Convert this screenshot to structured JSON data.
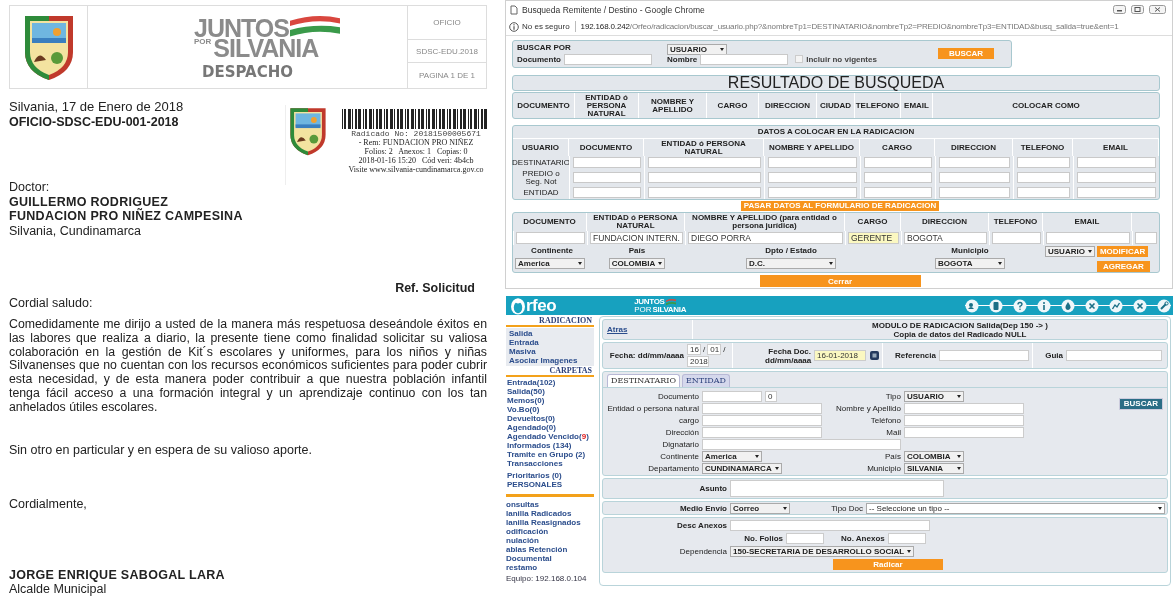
{
  "letter": {
    "header": {
      "brand_top": "JUNTOS",
      "brand_small": "POR",
      "brand_bottom": "SILVANIA",
      "office": "DESPACHO",
      "codes": [
        "OFICIO",
        "SDSC-EDU.2018",
        "PAGINA 1 DE 1"
      ]
    },
    "date": "Silvania, 17 de Enero de 2018",
    "reference_number": "OFICIO-SDSC-EDU-001-2018",
    "stamp": {
      "number": "Radicado No: 20181500005671",
      "lines": [
        "- Rem: FUNDACION PRO NIÑEZ",
        "Folios: 2   Anexos: 1   Copias: 0",
        "2018-01-16 15:20   Cód veri: 4b4cb",
        "Visite www.silvania-cundinamarca.gov.co"
      ]
    },
    "salutation": "Doctor:",
    "recipient": [
      "GUILLERMO  RODRIGUEZ",
      "FUNDACION PRO NIÑEZ CAMPESINA"
    ],
    "location": "Silvania, Cundinamarca",
    "subject": "Ref. Solicitud",
    "greeting": "Cordial saludo:",
    "body": "Comedidamente me dirijo a usted de la manera más respetuosa deseándole éxitos en las labores que realiza a diario, la presente tiene como finalidad solicitar su valiosa colaboración en la gestión de  Kit´s escolares y  uniformes, para los niños y niñas Silvanenses que no cuentan con los recursos económicos suficientes para poder cubrir esta necesidad,  y de esta manera poder contribuir a que nuestra población infantil tenga fácil acceso a una formación integral  y un aprendizaje continuo con los tan anhelados útiles escolares.",
    "closing_line": "Sin otro  en particular y en espera de su valioso aporte.",
    "closing": "Cordialmente,",
    "signer": "JORGE ENRIQUE SABOGAL LARA",
    "signer_title": "Alcalde Municipal"
  },
  "search_window": {
    "title": "Busqueda Remitente / Destino - Google Chrome",
    "security": "No es seguro",
    "url_host": "192.168.0.242",
    "url_path": "/Orfeo/radicacion/buscar_usuario.php?&nombreTp1=DESTINATARIO&nombreTp2=PREDIO&nombreTp3=ENTIDAD&busq_salida=true&ent=1",
    "search": {
      "heading": "BUSCAR POR",
      "type": "USUARIO",
      "document_label": "Documento",
      "name_label": "Nombre",
      "inactive": {
        "label": "Incluir no vigentes",
        "checked": false,
        "disabled": true
      },
      "button": "BUSCAR"
    },
    "results": {
      "title": "RESULTADO DE BUSQUEDA",
      "columns": [
        "DOCUMENTO",
        "ENTIDAD ó PERSONA NATURAL",
        "NOMBRE Y APELLIDO",
        "CARGO",
        "DIRECCION",
        "CIUDAD",
        "TELEFONO",
        "EMAIL",
        "COLOCAR COMO"
      ]
    },
    "target": {
      "title": "DATOS A COLOCAR EN LA RADICACION",
      "columns": [
        "USUARIO",
        "DOCUMENTO",
        "ENTIDAD ó PERSONA NATURAL",
        "NOMBRE Y APELLIDO",
        "CARGO",
        "DIRECCION",
        "TELEFONO",
        "EMAIL"
      ],
      "rows": [
        "DESTINATARIO",
        "PREDIO o Seg. Not",
        "ENTIDAD"
      ]
    },
    "transfer_button": "PASAR DATOS AL FORMULARIO DE RADICACION",
    "form": {
      "columns": [
        "DOCUMENTO",
        "ENTIDAD ó PERSONA NATURAL",
        "NOMBRE Y APELLIDO (para entidad o persona jurídica)",
        "CARGO",
        "DIRECCION",
        "TELEFONO",
        "EMAIL"
      ],
      "fields": [
        {
          "highlighted": false
        },
        {
          "value": "FUNDACION INTERN.",
          "highlighted": false
        },
        {
          "value": "DIEGO PORRA",
          "highlighted": false
        },
        {
          "value": "GERENTE",
          "highlighted": true
        },
        {
          "value": "BOGOTA",
          "highlighted": false
        },
        {
          "highlighted": false
        },
        {
          "highlighted": false
        },
        {
          "highlighted": false
        }
      ],
      "location_labels": [
        "Continente",
        "País",
        "Dpto / Estado",
        "Municipio"
      ],
      "location_values": [
        "America",
        "COLOMBIA",
        "D.C.",
        "BOGOTA"
      ],
      "role": "USUARIO",
      "modify_button": "MODIFICAR",
      "add_button": "AGREGAR"
    },
    "close_button": "Cerrar"
  },
  "orfeo": {
    "brand": "rfeo",
    "partner_top": "JUNTOS",
    "partner_small": "POR",
    "partner_bottom": "SILVANIA",
    "toolbar": [
      {
        "kind": "users"
      },
      {
        "kind": "document"
      },
      {
        "kind": "help"
      },
      {
        "kind": "info"
      },
      {
        "kind": "drop"
      },
      {
        "kind": "close"
      },
      {
        "kind": "chart"
      },
      {
        "kind": "close"
      },
      {
        "kind": "wrench"
      }
    ],
    "sidebar": {
      "sections": [
        {
          "title": "RADICACION",
          "items": [
            {
              "label": "Salida"
            },
            {
              "label": "Entrada"
            },
            {
              "label": "Masiva"
            },
            {
              "label": "Asociar Imagenes"
            }
          ]
        },
        {
          "title": "CARPETAS",
          "items": [
            {
              "label": "Entrada(102)"
            },
            {
              "label": "Salida(50)"
            },
            {
              "label": "Memos(0)"
            },
            {
              "label": "Vo.Bo(0)"
            },
            {
              "label": "Devueltos(0)"
            },
            {
              "label": "Agendado(0)"
            },
            {
              "label": "Agendado Vencido(",
              "alert": "9",
              "suffix": ")"
            },
            {
              "label": "Informados (134)"
            },
            {
              "label": "Tramite en Grupo (2)"
            },
            {
              "label": "Transacciones"
            }
          ]
        }
      ],
      "extra_folders": [
        "Prioritarios (0)",
        "PERSONALES"
      ],
      "tools": [
        "onsultas",
        "lanilla Radicados",
        "lanilla Reasignados",
        "odificación",
        "nulación",
        "ablas Retención Documental",
        "restamo"
      ],
      "footer": "Equipo: 192.168.0.104"
    },
    "back_link": "Atras",
    "module_title": "MODULO DE RADICACION Salida(Dep 150 -> )",
    "module_subtitle": "Copia de datos del Radicado NULL",
    "date_label": "Fecha: dd/mm/aaaa",
    "date_parts": [
      {
        "kind": "field",
        "text": "16"
      },
      {
        "kind": "separator",
        "text": "/"
      },
      {
        "kind": "field",
        "text": "01"
      },
      {
        "kind": "separator",
        "text": "/"
      },
      {
        "kind": "field",
        "text": "2018"
      }
    ],
    "doc_date_label": "Fecha Doc. dd/mm/aaaa",
    "doc_date": "16-01-2018",
    "reference_label": "Referencia",
    "guide_label": "Guia",
    "tabs": [
      {
        "label": "DESTINATARIO",
        "selected": true
      },
      {
        "label": "ENTIDAD",
        "selected": false
      }
    ],
    "fields": [
      [
        {
          "label": "Documento",
          "kind": "document",
          "extra": "0"
        },
        {
          "label": "Tipo",
          "kind": "select",
          "value": "USUARIO"
        }
      ],
      [
        {
          "label": "Entidad o persona natural",
          "kind": "text"
        },
        {
          "label": "Nombre y Apellido",
          "kind": "text"
        }
      ],
      [
        {
          "label": "cargo",
          "kind": "text"
        },
        {
          "label": "Teléfono",
          "kind": "text"
        }
      ],
      [
        {
          "label": "Dirección",
          "kind": "text"
        },
        {
          "label": "Mail",
          "kind": "text"
        }
      ],
      [
        {
          "label": "Dignatario",
          "kind": "wide"
        },
        {
          "kind": "blank"
        }
      ],
      [
        {
          "label": "Continente",
          "kind": "select",
          "value": "America"
        },
        {
          "label": "País",
          "kind": "select",
          "value": "COLOMBIA"
        }
      ],
      [
        {
          "label": "Departamento",
          "kind": "select",
          "value": "CUNDINAMARCA"
        },
        {
          "label": "Municipio",
          "kind": "select",
          "value": "SILVANIA"
        }
      ]
    ],
    "search_button": "BUSCAR",
    "subject_label": "Asunto",
    "delivery_label": "Medio Envío",
    "delivery": "Correo",
    "doc_type_label": "Tipo Doc",
    "doc_type": "-- Seleccione un tipo --",
    "annex_desc_label": "Desc Anexos",
    "folios_label": "No. Folios",
    "annexes_label": "No. Anexos",
    "dependency_label": "Dependencia",
    "dependency": "150-SECRETARIA DE DESARROLLO SOCIAL",
    "submit_button": "Radicar"
  }
}
